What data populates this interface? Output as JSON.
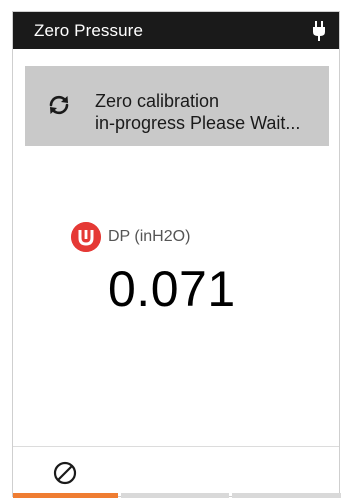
{
  "window": {
    "title": "Zero Pressure",
    "status_icon": "plug-icon"
  },
  "banner": {
    "icon": "refresh-icon",
    "line1": "Zero calibration",
    "line2": "in-progress Please Wait..."
  },
  "reading": {
    "badge_icon": "sensor-badge-icon",
    "label": "DP (inH2O)",
    "value": "0.071"
  },
  "footer": {
    "cancel_icon": "cancel-icon",
    "tabs": [
      {
        "active": true
      },
      {
        "active": false
      },
      {
        "active": false
      }
    ]
  },
  "colors": {
    "titlebar": "#1a1a1a",
    "banner": "#c9c9c9",
    "badge": "#e53935",
    "active_tab": "#ef7d32",
    "inactive_tab": "#d9d9d9"
  }
}
